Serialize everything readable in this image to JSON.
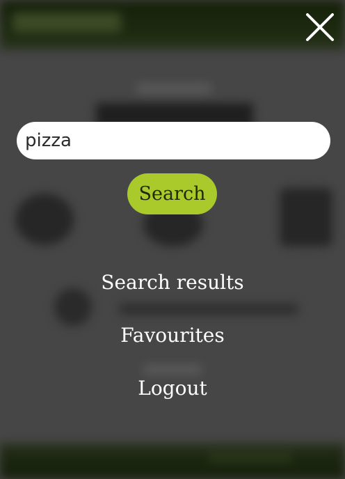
{
  "overlay": {
    "close_icon": "close-icon",
    "search": {
      "value": "pizza",
      "placeholder": ""
    },
    "search_button_label": "Search",
    "menu": {
      "search_results": "Search results",
      "favourites": "Favourites",
      "logout": "Logout"
    }
  },
  "colors": {
    "accent": "#aac92a",
    "overlay_bg": "#464646",
    "header_bg": "#1e2b10",
    "text_on_overlay": "#ffffff"
  }
}
